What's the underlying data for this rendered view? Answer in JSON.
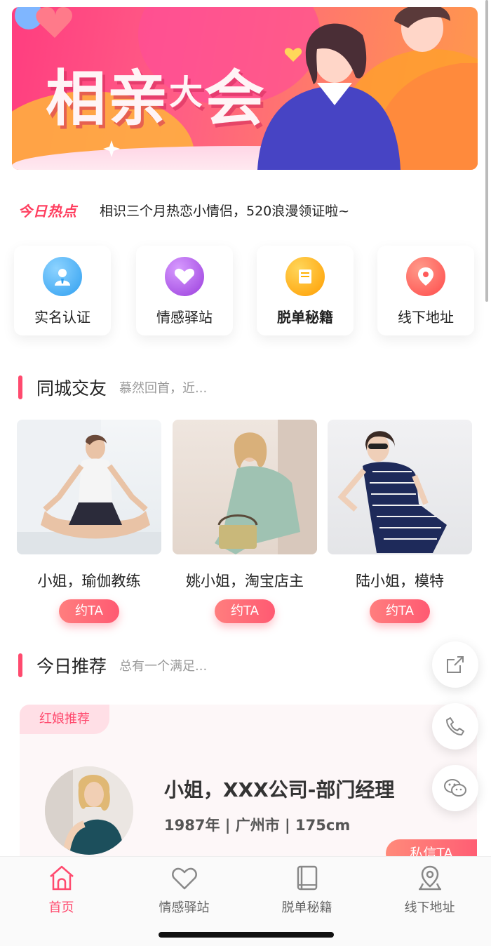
{
  "banner": {
    "title_main": "相亲",
    "title_small": "大",
    "title_end": "会"
  },
  "hot": {
    "tag": "今日热点",
    "text": "相识三个月热恋小情侣，520浪漫领证啦~"
  },
  "quick_entries": [
    {
      "label": "实名认证",
      "icon": "user-verify-icon",
      "color": "#36a9f5"
    },
    {
      "label": "情感驿站",
      "icon": "heart-icon",
      "color": "#b14ee6"
    },
    {
      "label": "脱单秘籍",
      "icon": "book-icon",
      "color": "#ffb000"
    },
    {
      "label": "线下地址",
      "icon": "location-pin-icon",
      "color": "#ff5a5a"
    }
  ],
  "section_city": {
    "title": "同城交友",
    "subtitle": "慕然回首，近..."
  },
  "friends": [
    {
      "name": "小姐，瑜伽教练",
      "button": "约TA"
    },
    {
      "name": "姚小姐，淘宝店主",
      "button": "约TA"
    },
    {
      "name": "陆小姐，模特",
      "button": "约TA"
    }
  ],
  "section_recommend": {
    "title": "今日推荐",
    "subtitle": "总有一个满足..."
  },
  "recommend": {
    "badge": "红娘推荐",
    "name": "小姐，XXX公司-部门经理",
    "info": "1987年 | 广州市 | 175cm",
    "button": "私信TA"
  },
  "tabs": [
    {
      "label": "首页",
      "icon": "home-icon",
      "active": true
    },
    {
      "label": "情感驿站",
      "icon": "heart-outline-icon",
      "active": false
    },
    {
      "label": "脱单秘籍",
      "icon": "book-outline-icon",
      "active": false
    },
    {
      "label": "线下地址",
      "icon": "map-pin-icon",
      "active": false
    }
  ],
  "colors": {
    "accent": "#ff4a6e",
    "banner_start": "#ff3d7f",
    "banner_end": "#ff9a4a"
  }
}
